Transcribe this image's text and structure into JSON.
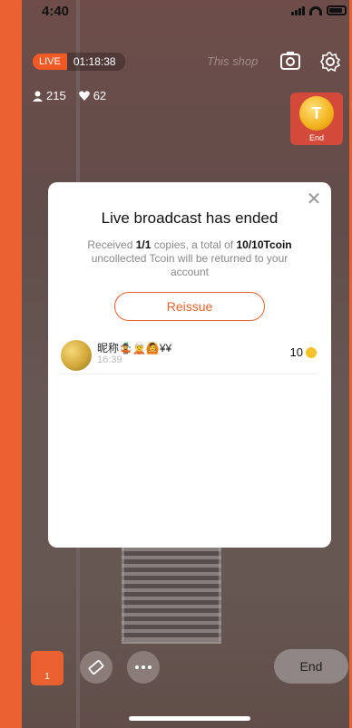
{
  "status_bar": {
    "time": "4:40"
  },
  "live": {
    "badge": "LIVE",
    "duration": "01:18:38",
    "shop_watermark": "This shop"
  },
  "stats": {
    "viewers": "215",
    "likes": "62"
  },
  "coin_widget": {
    "coin_letter": "T",
    "label": "End"
  },
  "dialog": {
    "title": "Live broadcast has ended",
    "msg_prefix": "Received ",
    "copies": "1/1",
    "msg_mid": " copies, a total of ",
    "total": "10/10Tcoin",
    "msg_suffix": " uncollected Tcoin will be returned to your account",
    "reissue_label": "Reissue",
    "records": [
      {
        "name": "昵称🤹🧝🙆¥¥",
        "time": "16:39",
        "amount": "10"
      }
    ]
  },
  "bottom_bar": {
    "bag_count": "1",
    "end_label": "End"
  },
  "colors": {
    "accent": "#e8612f",
    "coin": "#f5c22a"
  }
}
